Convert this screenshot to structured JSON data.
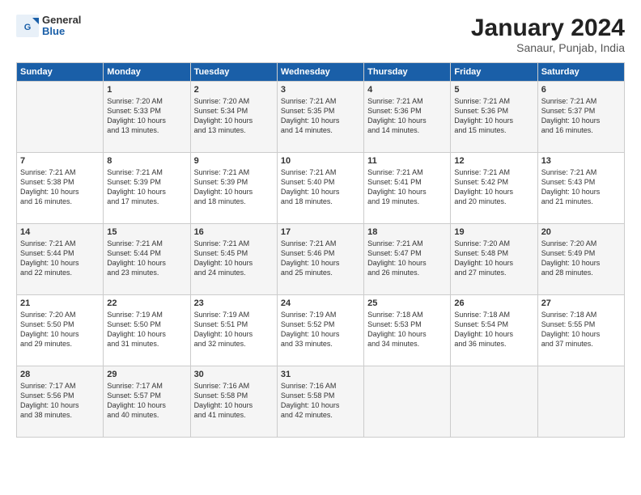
{
  "logo": {
    "line1": "General",
    "line2": "Blue"
  },
  "title": "January 2024",
  "location": "Sanaur, Punjab, India",
  "days_header": [
    "Sunday",
    "Monday",
    "Tuesday",
    "Wednesday",
    "Thursday",
    "Friday",
    "Saturday"
  ],
  "weeks": [
    [
      {
        "num": "",
        "lines": []
      },
      {
        "num": "1",
        "lines": [
          "Sunrise: 7:20 AM",
          "Sunset: 5:33 PM",
          "Daylight: 10 hours",
          "and 13 minutes."
        ]
      },
      {
        "num": "2",
        "lines": [
          "Sunrise: 7:20 AM",
          "Sunset: 5:34 PM",
          "Daylight: 10 hours",
          "and 13 minutes."
        ]
      },
      {
        "num": "3",
        "lines": [
          "Sunrise: 7:21 AM",
          "Sunset: 5:35 PM",
          "Daylight: 10 hours",
          "and 14 minutes."
        ]
      },
      {
        "num": "4",
        "lines": [
          "Sunrise: 7:21 AM",
          "Sunset: 5:36 PM",
          "Daylight: 10 hours",
          "and 14 minutes."
        ]
      },
      {
        "num": "5",
        "lines": [
          "Sunrise: 7:21 AM",
          "Sunset: 5:36 PM",
          "Daylight: 10 hours",
          "and 15 minutes."
        ]
      },
      {
        "num": "6",
        "lines": [
          "Sunrise: 7:21 AM",
          "Sunset: 5:37 PM",
          "Daylight: 10 hours",
          "and 16 minutes."
        ]
      }
    ],
    [
      {
        "num": "7",
        "lines": [
          "Sunrise: 7:21 AM",
          "Sunset: 5:38 PM",
          "Daylight: 10 hours",
          "and 16 minutes."
        ]
      },
      {
        "num": "8",
        "lines": [
          "Sunrise: 7:21 AM",
          "Sunset: 5:39 PM",
          "Daylight: 10 hours",
          "and 17 minutes."
        ]
      },
      {
        "num": "9",
        "lines": [
          "Sunrise: 7:21 AM",
          "Sunset: 5:39 PM",
          "Daylight: 10 hours",
          "and 18 minutes."
        ]
      },
      {
        "num": "10",
        "lines": [
          "Sunrise: 7:21 AM",
          "Sunset: 5:40 PM",
          "Daylight: 10 hours",
          "and 18 minutes."
        ]
      },
      {
        "num": "11",
        "lines": [
          "Sunrise: 7:21 AM",
          "Sunset: 5:41 PM",
          "Daylight: 10 hours",
          "and 19 minutes."
        ]
      },
      {
        "num": "12",
        "lines": [
          "Sunrise: 7:21 AM",
          "Sunset: 5:42 PM",
          "Daylight: 10 hours",
          "and 20 minutes."
        ]
      },
      {
        "num": "13",
        "lines": [
          "Sunrise: 7:21 AM",
          "Sunset: 5:43 PM",
          "Daylight: 10 hours",
          "and 21 minutes."
        ]
      }
    ],
    [
      {
        "num": "14",
        "lines": [
          "Sunrise: 7:21 AM",
          "Sunset: 5:44 PM",
          "Daylight: 10 hours",
          "and 22 minutes."
        ]
      },
      {
        "num": "15",
        "lines": [
          "Sunrise: 7:21 AM",
          "Sunset: 5:44 PM",
          "Daylight: 10 hours",
          "and 23 minutes."
        ]
      },
      {
        "num": "16",
        "lines": [
          "Sunrise: 7:21 AM",
          "Sunset: 5:45 PM",
          "Daylight: 10 hours",
          "and 24 minutes."
        ]
      },
      {
        "num": "17",
        "lines": [
          "Sunrise: 7:21 AM",
          "Sunset: 5:46 PM",
          "Daylight: 10 hours",
          "and 25 minutes."
        ]
      },
      {
        "num": "18",
        "lines": [
          "Sunrise: 7:21 AM",
          "Sunset: 5:47 PM",
          "Daylight: 10 hours",
          "and 26 minutes."
        ]
      },
      {
        "num": "19",
        "lines": [
          "Sunrise: 7:20 AM",
          "Sunset: 5:48 PM",
          "Daylight: 10 hours",
          "and 27 minutes."
        ]
      },
      {
        "num": "20",
        "lines": [
          "Sunrise: 7:20 AM",
          "Sunset: 5:49 PM",
          "Daylight: 10 hours",
          "and 28 minutes."
        ]
      }
    ],
    [
      {
        "num": "21",
        "lines": [
          "Sunrise: 7:20 AM",
          "Sunset: 5:50 PM",
          "Daylight: 10 hours",
          "and 29 minutes."
        ]
      },
      {
        "num": "22",
        "lines": [
          "Sunrise: 7:19 AM",
          "Sunset: 5:50 PM",
          "Daylight: 10 hours",
          "and 31 minutes."
        ]
      },
      {
        "num": "23",
        "lines": [
          "Sunrise: 7:19 AM",
          "Sunset: 5:51 PM",
          "Daylight: 10 hours",
          "and 32 minutes."
        ]
      },
      {
        "num": "24",
        "lines": [
          "Sunrise: 7:19 AM",
          "Sunset: 5:52 PM",
          "Daylight: 10 hours",
          "and 33 minutes."
        ]
      },
      {
        "num": "25",
        "lines": [
          "Sunrise: 7:18 AM",
          "Sunset: 5:53 PM",
          "Daylight: 10 hours",
          "and 34 minutes."
        ]
      },
      {
        "num": "26",
        "lines": [
          "Sunrise: 7:18 AM",
          "Sunset: 5:54 PM",
          "Daylight: 10 hours",
          "and 36 minutes."
        ]
      },
      {
        "num": "27",
        "lines": [
          "Sunrise: 7:18 AM",
          "Sunset: 5:55 PM",
          "Daylight: 10 hours",
          "and 37 minutes."
        ]
      }
    ],
    [
      {
        "num": "28",
        "lines": [
          "Sunrise: 7:17 AM",
          "Sunset: 5:56 PM",
          "Daylight: 10 hours",
          "and 38 minutes."
        ]
      },
      {
        "num": "29",
        "lines": [
          "Sunrise: 7:17 AM",
          "Sunset: 5:57 PM",
          "Daylight: 10 hours",
          "and 40 minutes."
        ]
      },
      {
        "num": "30",
        "lines": [
          "Sunrise: 7:16 AM",
          "Sunset: 5:58 PM",
          "Daylight: 10 hours",
          "and 41 minutes."
        ]
      },
      {
        "num": "31",
        "lines": [
          "Sunrise: 7:16 AM",
          "Sunset: 5:58 PM",
          "Daylight: 10 hours",
          "and 42 minutes."
        ]
      },
      {
        "num": "",
        "lines": []
      },
      {
        "num": "",
        "lines": []
      },
      {
        "num": "",
        "lines": []
      }
    ]
  ]
}
